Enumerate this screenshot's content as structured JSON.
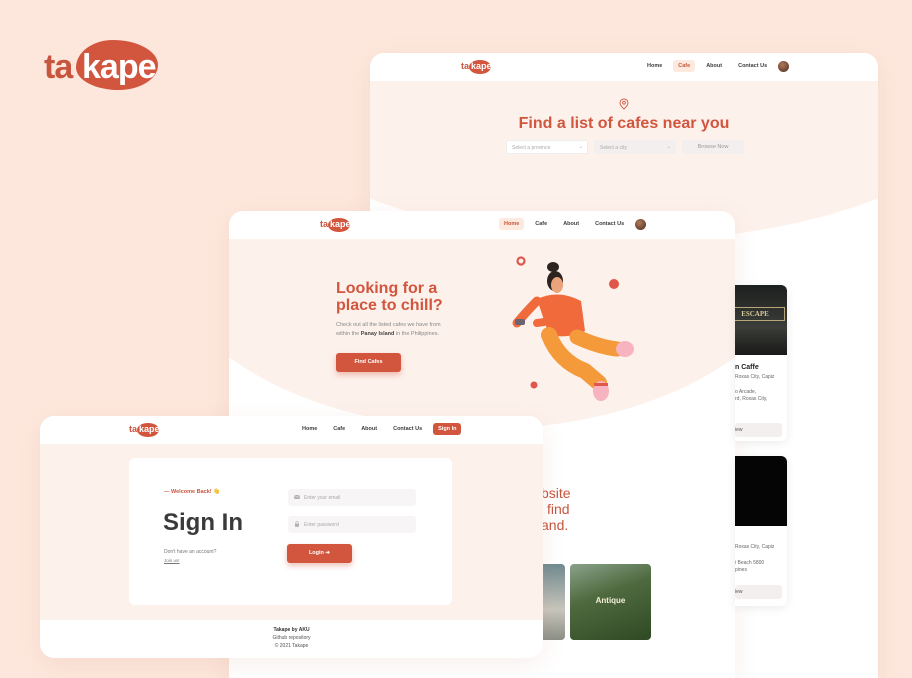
{
  "brand": {
    "ta": "ta",
    "kape": "kape"
  },
  "mini_logo": {
    "ta": "ta",
    "kape": "kape"
  },
  "cafes_page": {
    "nav": [
      "Home",
      "Cafe",
      "About",
      "Contact Us"
    ],
    "title": "Find a list of cafes near you",
    "province_placeholder": "Select a province",
    "city_placeholder": "Select a city",
    "browse": "Browse Now"
  },
  "cafe_cards": [
    {
      "name": "n Caffe",
      "addr1": "Roxas City, Capiz",
      "addr2": "o Arcade,",
      "addr3": "rd, Roxas City,",
      "button": "iew"
    },
    {
      "name": "",
      "addr1": "Roxas City, Capiz",
      "addr2": "i Beach 5800",
      "addr3": "pines",
      "button": "iew"
    }
  ],
  "home_page": {
    "nav": [
      "Home",
      "Cafe",
      "About",
      "Contact Us"
    ],
    "title_line1": "Looking for a",
    "title_line2": "place to chill?",
    "desc_line1": "Check out all the listed cafes we have from",
    "desc_pre": "within the ",
    "desc_bold": "Panay Island",
    "desc_post": " in the Philippines.",
    "find_button": "Find Cafes",
    "tagline": [
      "bsite",
      "find",
      "and."
    ],
    "photo_label": "Antique"
  },
  "signin_page": {
    "nav": [
      "Home",
      "Cafe",
      "About",
      "Contact Us"
    ],
    "signin_link": "Sign In",
    "welcome": "— Welcome Back! 👋",
    "heading": "Sign In",
    "no_account": "Don't have an account?",
    "join": "Join us!",
    "email_placeholder": "Enter your email",
    "password_placeholder": "Enter password",
    "login_button": "Login ➔",
    "footer_title": "Takape by AKU",
    "footer_repo": "Github repository",
    "footer_copy": "© 2021 Takape"
  },
  "colors": {
    "accent": "#d2553e",
    "background": "#fde7dc",
    "hero": "#fdf1ec"
  }
}
